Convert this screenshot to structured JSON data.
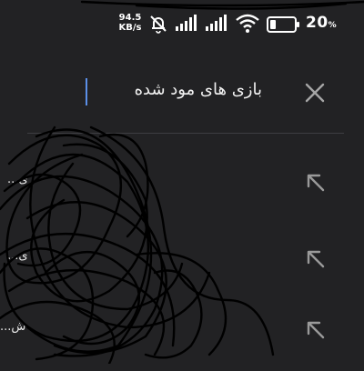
{
  "status_bar": {
    "net_speed_value": "94.5",
    "net_speed_unit": "KB/s",
    "battery_percent": "20",
    "battery_percent_sign": "%",
    "icons": [
      "bell-off-icon",
      "signal-icon",
      "signal-icon",
      "wifi-icon",
      "battery-icon"
    ]
  },
  "search": {
    "query": "بازی های مود شده",
    "clear_icon": "close-icon"
  },
  "suggestions": [
    {
      "text": "...ی",
      "action_icon": "arrow-up-left-icon"
    },
    {
      "text": "...ی",
      "action_icon": "arrow-up-left-icon"
    },
    {
      "text": "...ش",
      "action_icon": "arrow-up-left-icon"
    }
  ],
  "colors": {
    "background": "#222224",
    "caret": "#5b8fe8",
    "icon": "#9a9a9a",
    "text": "#ffffff"
  }
}
